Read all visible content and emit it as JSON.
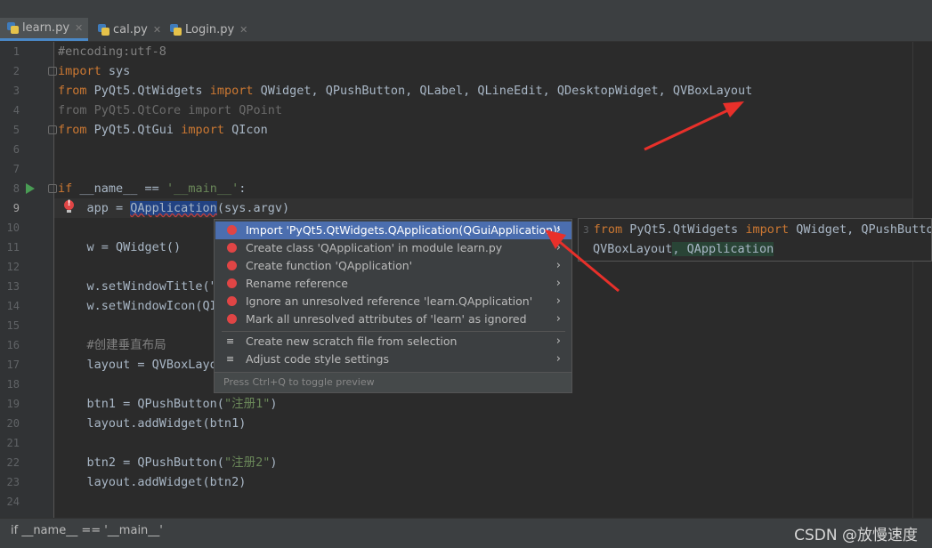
{
  "tabs": [
    {
      "label": "learn.py",
      "active": true
    },
    {
      "label": "cal.py",
      "active": false
    },
    {
      "label": "Login.py",
      "active": false
    }
  ],
  "line_numbers": [
    "1",
    "2",
    "3",
    "4",
    "5",
    "6",
    "7",
    "8",
    "9",
    "10",
    "11",
    "12",
    "13",
    "14",
    "15",
    "16",
    "17",
    "18",
    "19",
    "20",
    "21",
    "22",
    "23",
    "24"
  ],
  "code": {
    "l1": "#encoding:utf-8",
    "l2_kw": "import",
    "l2_rest": " sys",
    "l3_kw1": "from",
    "l3_mod": " PyQt5.QtWidgets ",
    "l3_kw2": "import",
    "l3_rest": " QWidget, QPushButton, QLabel, QLineEdit, QDesktopWidget, QVBoxLayout",
    "l4": "from PyQt5.QtCore import QPoint",
    "l5_kw1": "from",
    "l5_mod": " PyQt5.QtGui ",
    "l5_kw2": "import",
    "l5_rest": " QIcon",
    "l8_kw": "if",
    "l8_mid": " __name__ == ",
    "l8_str": "'__main__'",
    "l8_end": ":",
    "l9_pre": "    app = ",
    "l9_hl": "QApplication",
    "l9_post": "(sys.argv)",
    "l11": "    w = QWidget()",
    "l13": "    w.setWindowTitle(\"",
    "l14": "    w.setWindowIcon(QI",
    "l16": "    #创建垂直布局",
    "l17": "    layout = QVBoxLayo",
    "l19_pre": "    btn1 = QPushButton(",
    "l19_str": "\"注册1\"",
    "l19_post": ")",
    "l20": "    layout.addWidget(btn1)",
    "l22_pre": "    btn2 = QPushButton(",
    "l22_str": "\"注册2\"",
    "l22_post": ")",
    "l23": "    layout.addWidget(btn2)"
  },
  "popup": {
    "items": [
      {
        "label": "Import 'PyQt5.QtWidgets.QApplication(QGuiApplication)'",
        "icon": "error-bulb-icon"
      },
      {
        "label": "Create class 'QApplication' in module learn.py",
        "icon": "error-bulb-icon"
      },
      {
        "label": "Create function 'QApplication'",
        "icon": "error-bulb-icon"
      },
      {
        "label": "Rename reference",
        "icon": "error-bulb-icon"
      },
      {
        "label": "Ignore an unresolved reference 'learn.QApplication'",
        "icon": "error-bulb-icon"
      },
      {
        "label": "Mark all unresolved attributes of 'learn' as ignored",
        "icon": "error-bulb-icon"
      },
      {
        "label": "Create new scratch file from selection",
        "icon": "scratch-icon"
      },
      {
        "label": "Adjust code style settings",
        "icon": "code-style-icon"
      }
    ],
    "hint": "Press Ctrl+Q to toggle preview"
  },
  "preview": {
    "line_no": "3",
    "l1_kw1": "from",
    "l1_mod": " PyQt5.QtWidgets ",
    "l1_kw2": "import",
    "l1_rest": " QWidget, QPushButton",
    "l2_pre": "QVBoxLayout",
    "l2_green": ", QApplication"
  },
  "status": {
    "breadcrumb": "if __name__ == '__main__'"
  },
  "watermark": "CSDN @放慢速度",
  "colors": {
    "accent": "#4b6eaf",
    "error": "#e04545",
    "annotation_arrow": "#e8302a"
  }
}
